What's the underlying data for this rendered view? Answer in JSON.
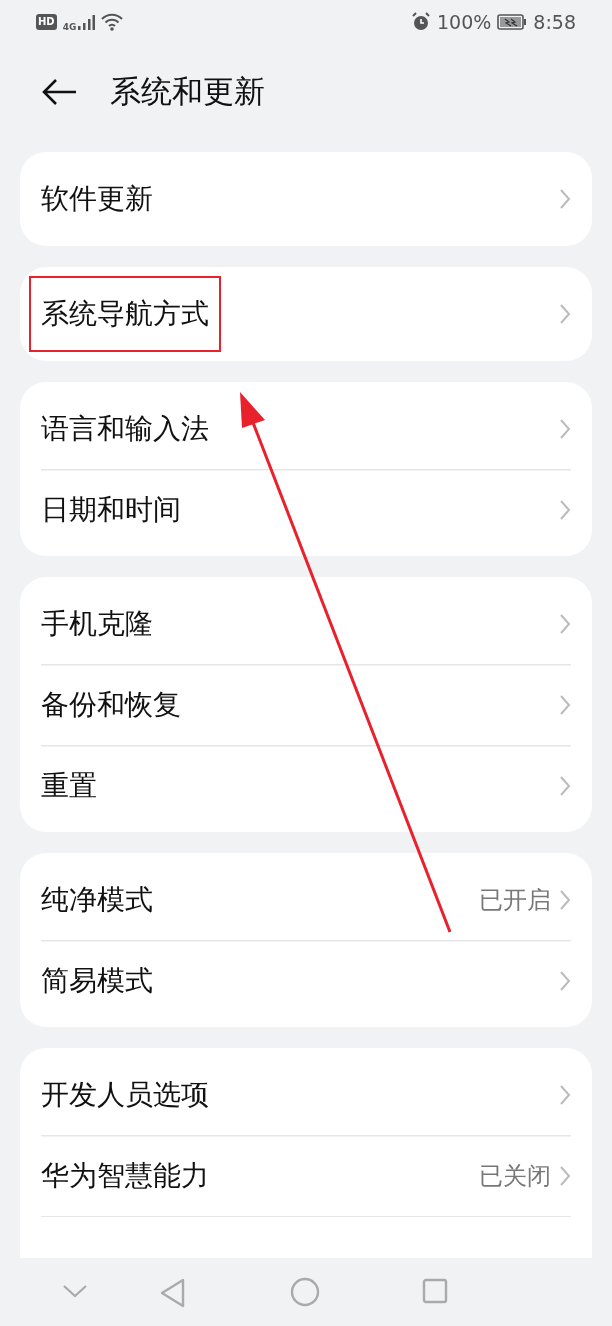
{
  "status_bar": {
    "hd": "HD",
    "network": "4G",
    "battery": "100%",
    "time": "8:58"
  },
  "header": {
    "title": "系统和更新"
  },
  "groups": [
    {
      "items": [
        {
          "label": "软件更新",
          "boxed": false
        }
      ]
    },
    {
      "items": [
        {
          "label": "系统导航方式",
          "boxed": true
        }
      ]
    },
    {
      "items": [
        {
          "label": "语言和输入法",
          "boxed": false
        },
        {
          "label": "日期和时间",
          "boxed": false
        }
      ]
    },
    {
      "items": [
        {
          "label": "手机克隆",
          "boxed": false
        },
        {
          "label": "备份和恢复",
          "boxed": false
        },
        {
          "label": "重置",
          "boxed": false
        }
      ]
    },
    {
      "items": [
        {
          "label": "纯净模式",
          "value": "已开启",
          "boxed": false
        },
        {
          "label": "简易模式",
          "boxed": false
        }
      ]
    },
    {
      "continues": true,
      "items": [
        {
          "label": "开发人员选项",
          "boxed": false
        },
        {
          "label": "华为智慧能力",
          "value": "已关闭",
          "boxed": false
        }
      ]
    }
  ],
  "annotations": [
    {
      "kind": "arrow"
    }
  ]
}
